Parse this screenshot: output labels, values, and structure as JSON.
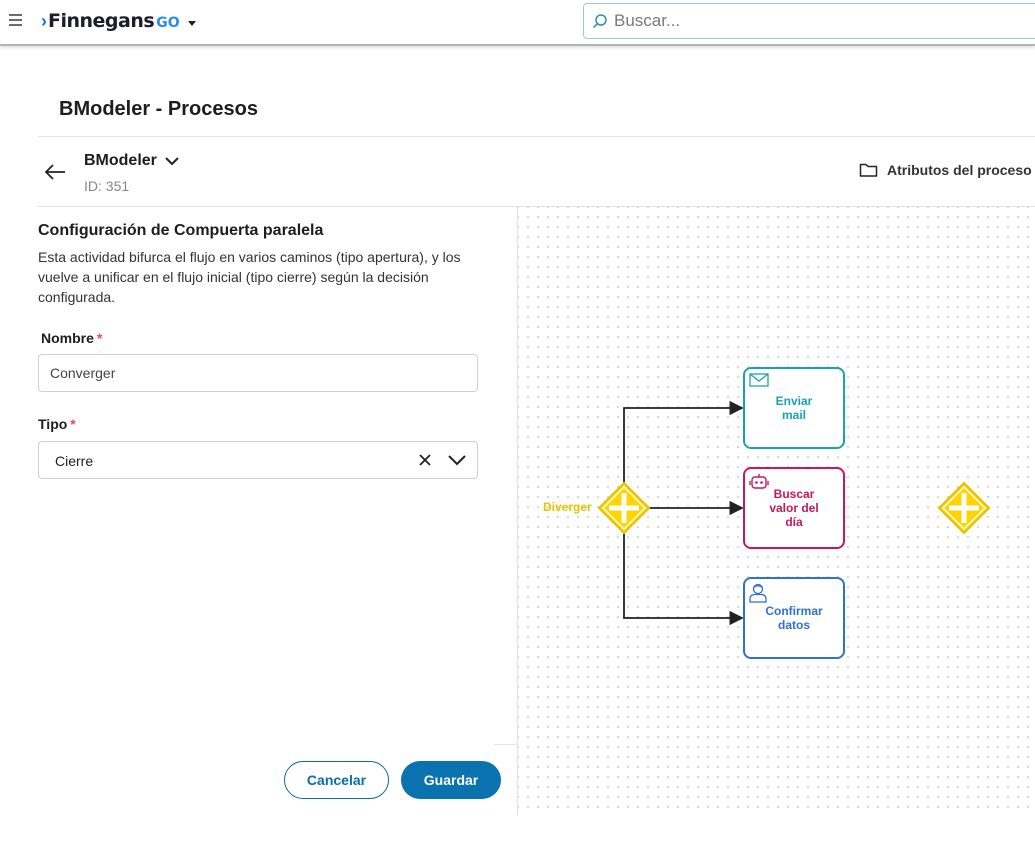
{
  "header": {
    "brand": "Finnegans",
    "brand_suffix": "GO",
    "search_placeholder": "Buscar..."
  },
  "page": {
    "title": "BModeler - Procesos"
  },
  "process": {
    "name": "BModeler",
    "id_label": "ID: 351",
    "attributes_label": "Atributos del proceso"
  },
  "config": {
    "title": "Configuración de Compuerta paralela",
    "description": "Esta actividad bifurca el flujo en varios caminos (tipo apertura), y los vuelve a unificar en el flujo inicial (tipo cierre) según la decisión configurada.",
    "name_label": "Nombre",
    "name_value": "Converger",
    "type_label": "Tipo",
    "type_value": "Cierre",
    "required_mark": "*"
  },
  "actions": {
    "cancel_label": "Cancelar",
    "save_label": "Guardar"
  },
  "diagram": {
    "gateway_label": "Diverger",
    "tasks": [
      {
        "label": "Enviar\nmail",
        "icon": "mail-icon",
        "color": "#1ba3ad"
      },
      {
        "label": "Buscar\nvalor del\ndía",
        "icon": "robot-icon",
        "color": "#c8185a"
      },
      {
        "label": "Confirmar\ndatos",
        "icon": "user-icon",
        "color": "#2f6fd6"
      }
    ],
    "gateway_color": "#ffd500",
    "gateway_stroke": "#e6c300",
    "flow_color": "#222222"
  },
  "colors": {
    "primary": "#0a72ae",
    "required": "#d9534f",
    "brand_blue": "#1a73e8"
  }
}
